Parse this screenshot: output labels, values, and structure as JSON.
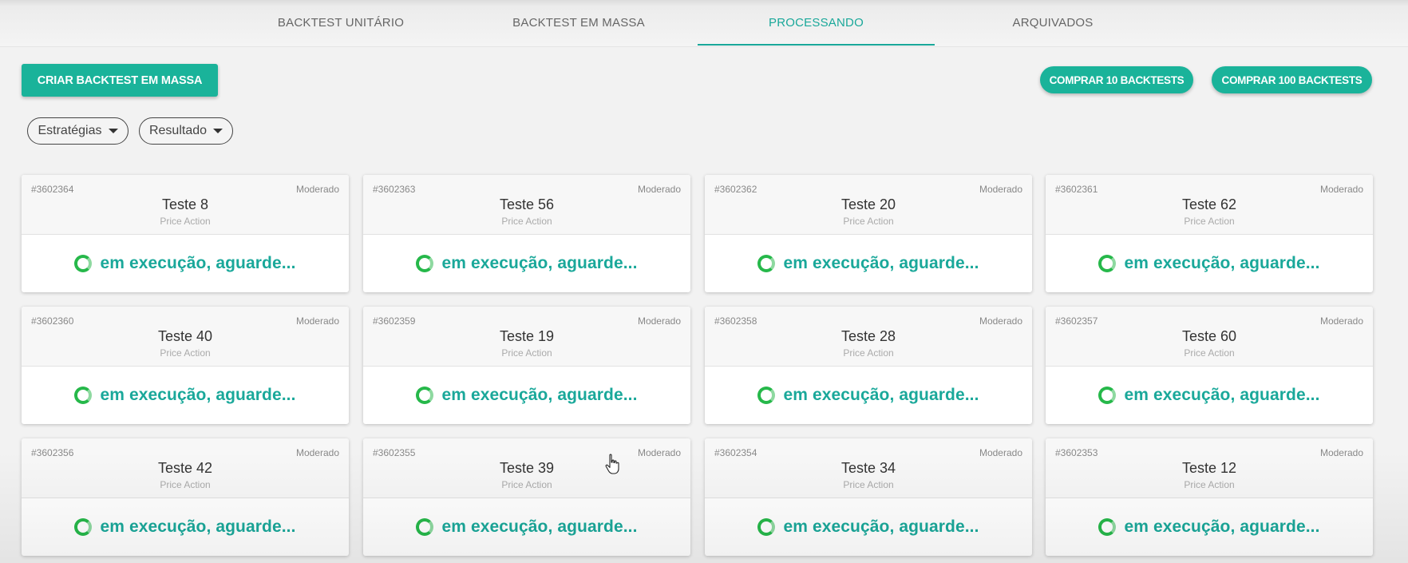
{
  "tabs": [
    {
      "label": "BACKTEST UNITÁRIO",
      "active": false
    },
    {
      "label": "BACKTEST EM MASSA",
      "active": false
    },
    {
      "label": "PROCESSANDO",
      "active": true
    },
    {
      "label": "ARQUIVADOS",
      "active": false
    }
  ],
  "toolbar": {
    "create_label": "CRIAR BACKTEST EM MASSA",
    "buy10_label": "COMPRAR 10 BACKTESTS",
    "buy100_label": "COMPRAR 100 BACKTESTS"
  },
  "filters": {
    "strategies_label": "Estratégias",
    "result_label": "Resultado"
  },
  "status_text": "em execução, aguarde...",
  "cards": [
    {
      "id": "#3602364",
      "risk": "Moderado",
      "name": "Teste 8",
      "type": "Price Action"
    },
    {
      "id": "#3602363",
      "risk": "Moderado",
      "name": "Teste 56",
      "type": "Price Action"
    },
    {
      "id": "#3602362",
      "risk": "Moderado",
      "name": "Teste 20",
      "type": "Price Action"
    },
    {
      "id": "#3602361",
      "risk": "Moderado",
      "name": "Teste 62",
      "type": "Price Action"
    },
    {
      "id": "#3602360",
      "risk": "Moderado",
      "name": "Teste 40",
      "type": "Price Action"
    },
    {
      "id": "#3602359",
      "risk": "Moderado",
      "name": "Teste 19",
      "type": "Price Action"
    },
    {
      "id": "#3602358",
      "risk": "Moderado",
      "name": "Teste 28",
      "type": "Price Action"
    },
    {
      "id": "#3602357",
      "risk": "Moderado",
      "name": "Teste 60",
      "type": "Price Action"
    },
    {
      "id": "#3602356",
      "risk": "Moderado",
      "name": "Teste 42",
      "type": "Price Action"
    },
    {
      "id": "#3602355",
      "risk": "Moderado",
      "name": "Teste 39",
      "type": "Price Action"
    },
    {
      "id": "#3602354",
      "risk": "Moderado",
      "name": "Teste 34",
      "type": "Price Action"
    },
    {
      "id": "#3602353",
      "risk": "Moderado",
      "name": "Teste 12",
      "type": "Price Action"
    }
  ],
  "colors": {
    "accent": "#1ab39a",
    "status_text": "#1aa89a",
    "spinner": "#26b84a"
  },
  "icons": {
    "dropdown": "caret-down-icon",
    "spinner": "loading-spinner-icon",
    "cursor": "hand-pointer-icon"
  }
}
